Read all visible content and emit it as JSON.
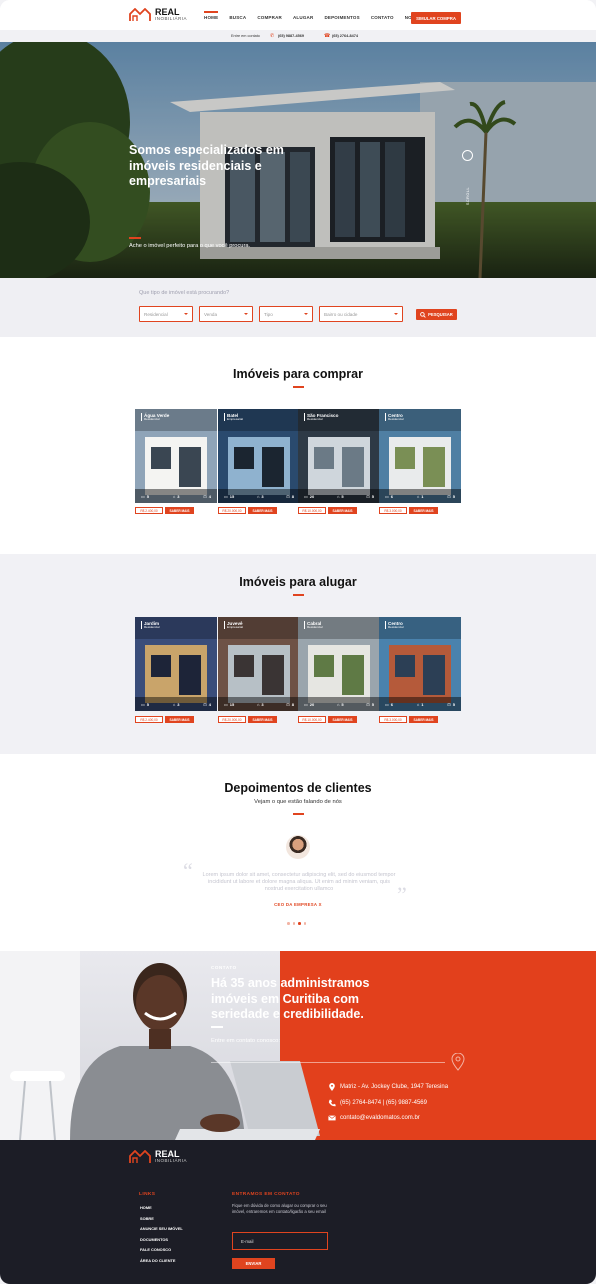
{
  "brand": {
    "name": "REAL",
    "sub": "INOBILIÁRIA"
  },
  "nav": {
    "items": [
      "HOME",
      "BUSCA",
      "COMPRAR",
      "ALUGAR",
      "DEPOIMENTOS",
      "CONTATO",
      "NOTÍCIAS"
    ],
    "active": "HOME",
    "cta": "SIMULAR COMPRA"
  },
  "subbar": {
    "label": "Entre em contato",
    "whatsapp": "(65) 9887-4569",
    "phone": "(65) 2764-8474"
  },
  "hero": {
    "title": "Somos especializados em imóveis residenciais e empresariais",
    "subtitle": "Ache o imóvel perfeito para o que você procura.",
    "side_label": "SCROLL"
  },
  "search": {
    "label": "Que tipo de imóvel está procurando?",
    "fields": [
      "Residencial",
      "Venda",
      "Tipo",
      "Bairro ou cidade"
    ],
    "button": "PESQUISAR"
  },
  "buy": {
    "title": "Imóveis para comprar",
    "cards": [
      {
        "loc": "Água Verde",
        "type": "Residencial",
        "f1": "5",
        "f2": "3",
        "f3": "4",
        "price": "R$ 2.400,00",
        "more": "SABER MAIS"
      },
      {
        "loc": "Batel",
        "type": "Empresarial",
        "f1": "15",
        "f2": "3",
        "f3": "8",
        "price": "R$ 20.000,00",
        "more": "SABER MAIS"
      },
      {
        "loc": "São Francisco",
        "type": "Residencial",
        "f1": "20",
        "f2": "5",
        "f3": "5",
        "price": "R$ 10.000,00",
        "more": "SABER MAIS"
      },
      {
        "loc": "Centro",
        "type": "Residencial",
        "f1": "6",
        "f2": "1",
        "f3": "5",
        "price": "R$ 3.000,00",
        "more": "SABER MAIS"
      }
    ]
  },
  "rent": {
    "title": "Imóveis para alugar",
    "cards": [
      {
        "loc": "Jardim",
        "type": "Residencial",
        "f1": "5",
        "f2": "3",
        "f3": "4",
        "price": "R$ 2.400,00",
        "more": "SABER MAIS"
      },
      {
        "loc": "Juvevê",
        "type": "Empresarial",
        "f1": "15",
        "f2": "3",
        "f3": "8",
        "price": "R$ 20.000,00",
        "more": "SABER MAIS"
      },
      {
        "loc": "Cabral",
        "type": "Residencial",
        "f1": "20",
        "f2": "5",
        "f3": "5",
        "price": "R$ 10.000,00",
        "more": "SABER MAIS"
      },
      {
        "loc": "Centro",
        "type": "Residencial",
        "f1": "6",
        "f2": "1",
        "f3": "5",
        "price": "R$ 3.000,00",
        "more": "SABER MAIS"
      }
    ]
  },
  "testimonials": {
    "title": "Depoimentos de clientes",
    "subtitle": "Vejam o que estão falando de nós",
    "quote": "Lorem ipsum dolor sit amet, consectetur adipiscing elit, sed do eiusmod tempor incididunt ut labore et dolore magna aliqua. Ut enim ad minim veniam, quis nostrud exercitation ullamco",
    "author": "CEO DA EMPRESA X",
    "dots_active": 2
  },
  "contact": {
    "kicker": "CONTATO",
    "title": "Há 35 anos administramos imóveis em Curitiba com seriedade e credibilidade.",
    "subtitle": "Entre em contato conosco:",
    "address": "Matriz - Av. Jockey Clube, 1947 Teresina",
    "phones": "(65) 2764-8474 | (65) 9887-4569",
    "email": "contato@evaldomatos.com.br"
  },
  "footer": {
    "links_title": "LINKS",
    "links": [
      "HOME",
      "SOBRE",
      "ANUNCIE SEU IMÓVEL",
      "DOCUMENTOS",
      "FALE CONOSCO",
      "ÁREA DO CLIENTE"
    ],
    "news_title": "ENTRAMOS EM CONTATO",
    "news_text": "Fique em dúvida de como alugar ou comprar o seu imóvel, entraremos em contato/ligarão a seu email",
    "email_placeholder": "E-mail",
    "send": "ENVIAR"
  },
  "colors": {
    "accent": "#e0441f",
    "dark": "#1c1d26",
    "band": "#f1f1f5"
  }
}
